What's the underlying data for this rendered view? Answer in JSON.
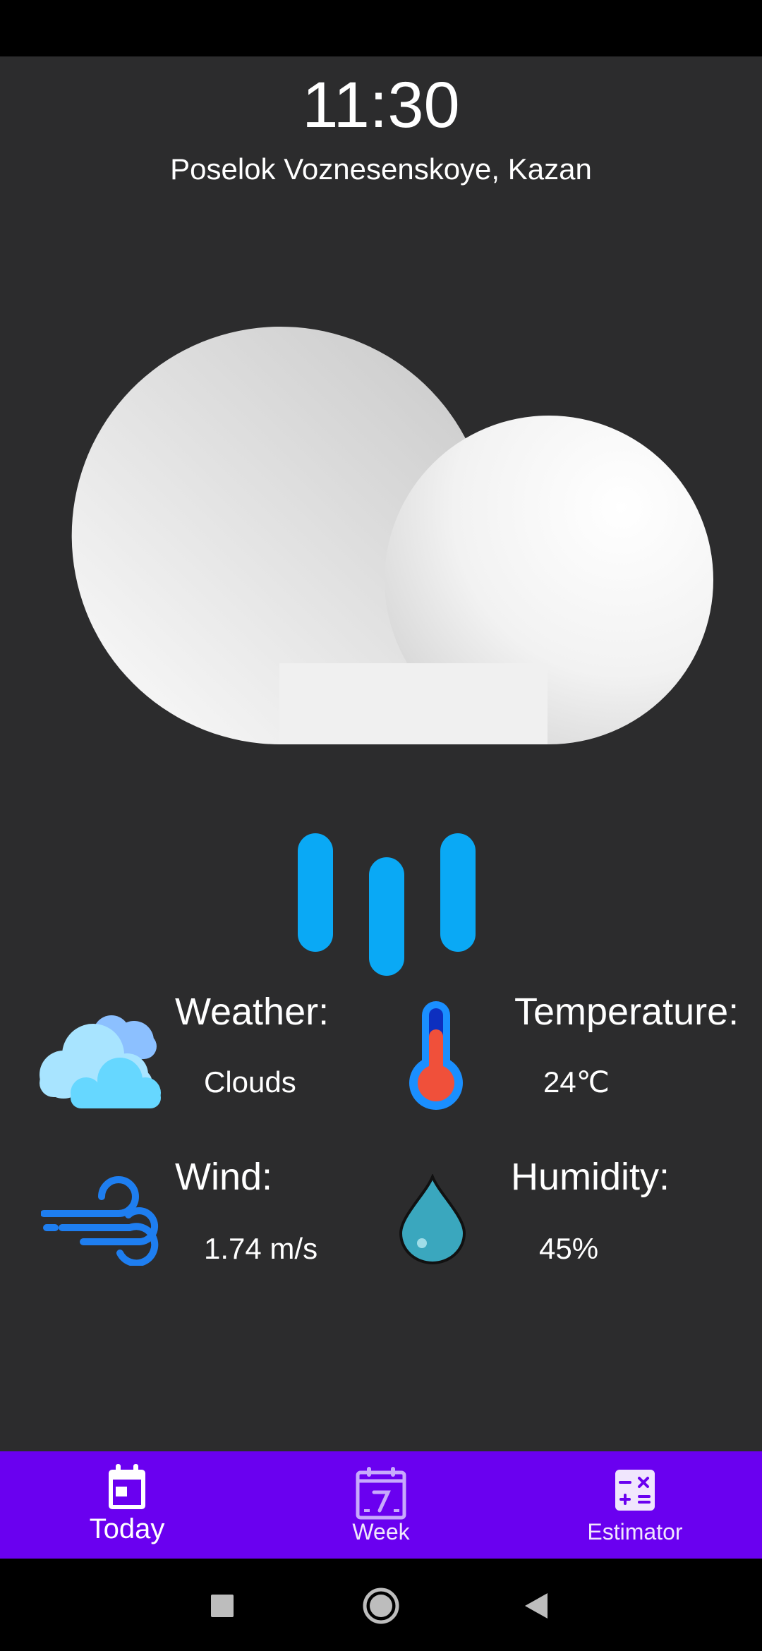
{
  "header": {
    "time": "11:30",
    "location": "Poselok Voznesenskoye, Kazan"
  },
  "hero": {
    "icon": "cloud-rain-icon"
  },
  "stats": {
    "weather": {
      "label": "Weather:",
      "value": "Clouds",
      "icon": "clouds-icon"
    },
    "temperature": {
      "label": "Temperature:",
      "value": "24℃",
      "icon": "thermometer-icon"
    },
    "wind": {
      "label": "Wind:",
      "value": "1.74 m/s",
      "icon": "wind-icon"
    },
    "humidity": {
      "label": "Humidity:",
      "value": "45%",
      "icon": "water-drop-icon"
    }
  },
  "bottom_nav": {
    "items": [
      {
        "label": "Today",
        "icon": "calendar-today-icon",
        "selected": true
      },
      {
        "label": "Week",
        "icon": "calendar-week-icon",
        "selected": false
      },
      {
        "label": "Estimator",
        "icon": "calculator-icon",
        "selected": false
      }
    ]
  },
  "system_nav": {
    "recents": "recents-square-icon",
    "home": "home-circle-icon",
    "back": "back-triangle-icon"
  },
  "colors": {
    "background": "#2c2c2d",
    "nav_bar": "#6a00f0",
    "rain": "#0aa9f5",
    "text": "#ffffff"
  }
}
